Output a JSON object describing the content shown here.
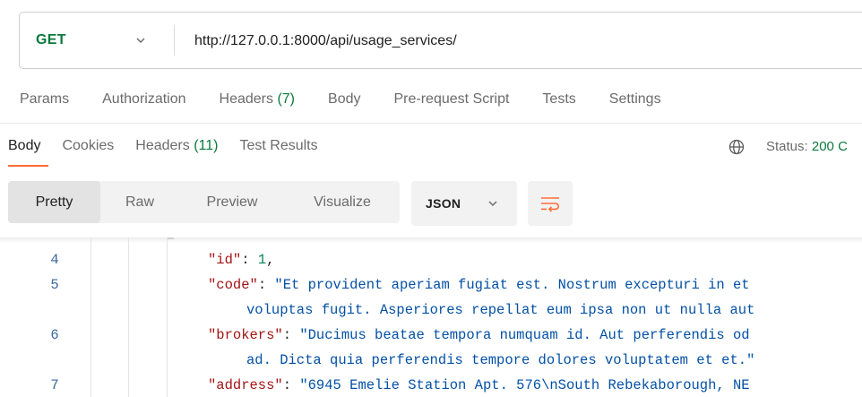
{
  "request": {
    "method": "GET",
    "url": "http://127.0.0.1:8000/api/usage_services/"
  },
  "request_tabs": [
    {
      "label": "Params"
    },
    {
      "label": "Authorization"
    },
    {
      "label": "Headers",
      "count": "(7)"
    },
    {
      "label": "Body"
    },
    {
      "label": "Pre-request Script"
    },
    {
      "label": "Tests"
    },
    {
      "label": "Settings"
    }
  ],
  "response_tabs": [
    {
      "label": "Body"
    },
    {
      "label": "Cookies"
    },
    {
      "label": "Headers",
      "count": "(11)"
    },
    {
      "label": "Test Results"
    }
  ],
  "status": {
    "label": "Status:",
    "value": "200 C"
  },
  "view_modes": [
    "Pretty",
    "Raw",
    "Preview",
    "Visualize"
  ],
  "format": "JSON",
  "code_lines": [
    {
      "ln": "4",
      "key": "\"id\"",
      "sep": ": ",
      "value": "1",
      "type": "number",
      "tail": ","
    },
    {
      "ln": "5",
      "key": "\"code\"",
      "sep": ": ",
      "value": "\"Et provident aperiam fugiat est. Nostrum excepturi in et",
      "type": "string",
      "tail": ""
    },
    {
      "ln": "",
      "key": "",
      "sep": "",
      "value": "voluptas fugit. Asperiores repellat eum ipsa non ut nulla aut",
      "type": "string",
      "tail": ""
    },
    {
      "ln": "6",
      "key": "\"brokers\"",
      "sep": ": ",
      "value": "\"Ducimus beatae tempora numquam id. Aut perferendis od",
      "type": "string",
      "tail": ""
    },
    {
      "ln": "",
      "key": "",
      "sep": "",
      "value": "ad. Dicta quia perferendis tempore dolores voluptatem et et.\"",
      "type": "string",
      "tail": ""
    },
    {
      "ln": "7",
      "key": "\"address\"",
      "sep": ": ",
      "value": "\"6945 Emelie Station Apt. 576\\nSouth Rebekaborough, NE",
      "type": "string",
      "tail": ""
    }
  ],
  "colors": {
    "method": "#0b7a3c",
    "accent": "#ff6c37",
    "status_ok": "#0b7a3c",
    "json_key": "#a31515",
    "json_string": "#0451a5",
    "json_number": "#098658"
  },
  "icons": [
    "chevron-down-icon",
    "globe-icon",
    "wrap-lines-icon"
  ]
}
